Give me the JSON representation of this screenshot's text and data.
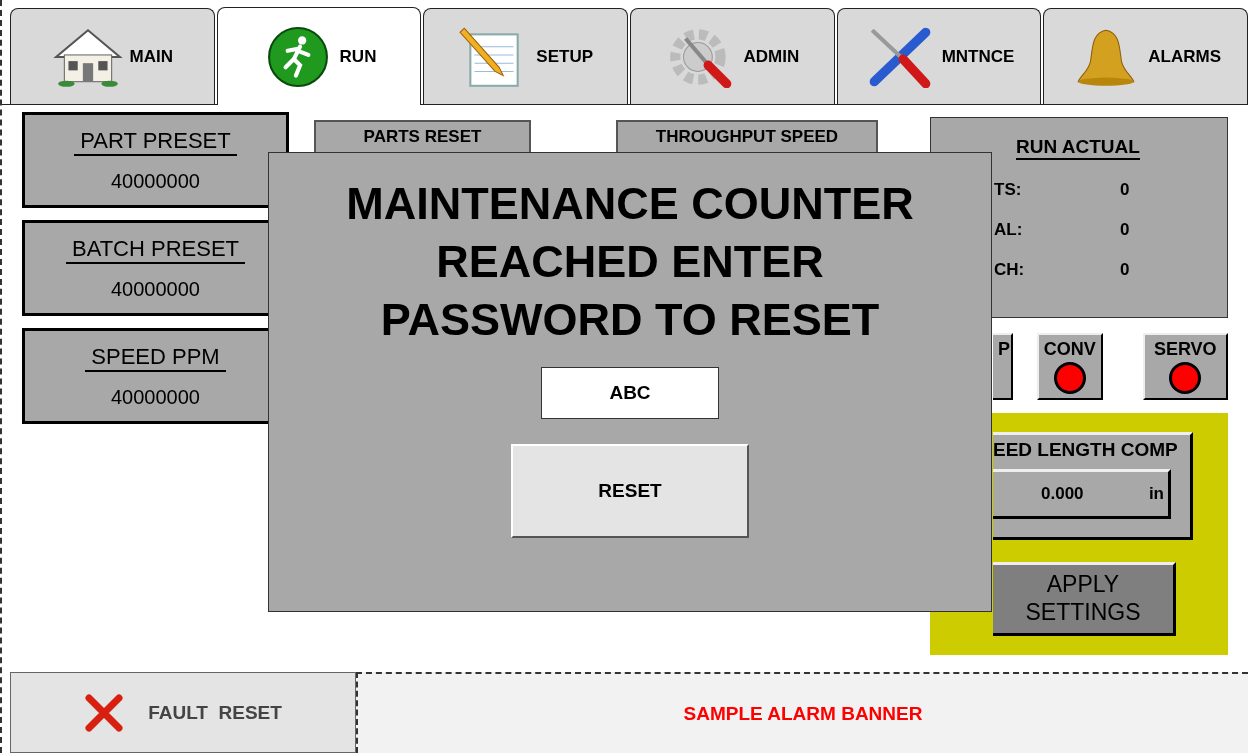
{
  "tabs": [
    {
      "label": "MAIN",
      "kind": "house",
      "selected": false
    },
    {
      "label": "RUN",
      "kind": "runner",
      "selected": true
    },
    {
      "label": "SETUP",
      "kind": "notepad",
      "selected": false
    },
    {
      "label": "ADMIN",
      "kind": "gear",
      "selected": false
    },
    {
      "label": "MNTNCE",
      "kind": "tools",
      "selected": false
    },
    {
      "label": "ALARMS",
      "kind": "bell",
      "selected": false
    }
  ],
  "presets": [
    {
      "label": "PART PRESET",
      "value": "40000000"
    },
    {
      "label": "BATCH PRESET",
      "value": "40000000"
    },
    {
      "label": "SPEED PPM",
      "value": "40000000"
    }
  ],
  "middle_headers": [
    "PARTS RESET",
    "THROUGHPUT SPEED"
  ],
  "run_actual": {
    "title": "RUN ACTUAL",
    "rows": [
      {
        "label": "TS:",
        "value": "0"
      },
      {
        "label": "AL:",
        "value": "0"
      },
      {
        "label": "CH:",
        "value": "0"
      }
    ]
  },
  "indicators": [
    {
      "label": "P"
    },
    {
      "label": "CONV",
      "on": false
    },
    {
      "label": "SERVO",
      "on": false
    }
  ],
  "feed_length_comp": {
    "label": "EED LENGTH COMP",
    "value": "0.000",
    "unit": "in"
  },
  "apply_button": "APPLY SETTINGS",
  "modal": {
    "message": "MAINTENANCE COUNTER\nREACHED ENTER\nPASSWORD TO RESET",
    "password": "ABC",
    "button": "RESET"
  },
  "footer": {
    "fault_reset": "FAULT  RESET",
    "alarm_banner": "SAMPLE ALARM BANNER"
  }
}
